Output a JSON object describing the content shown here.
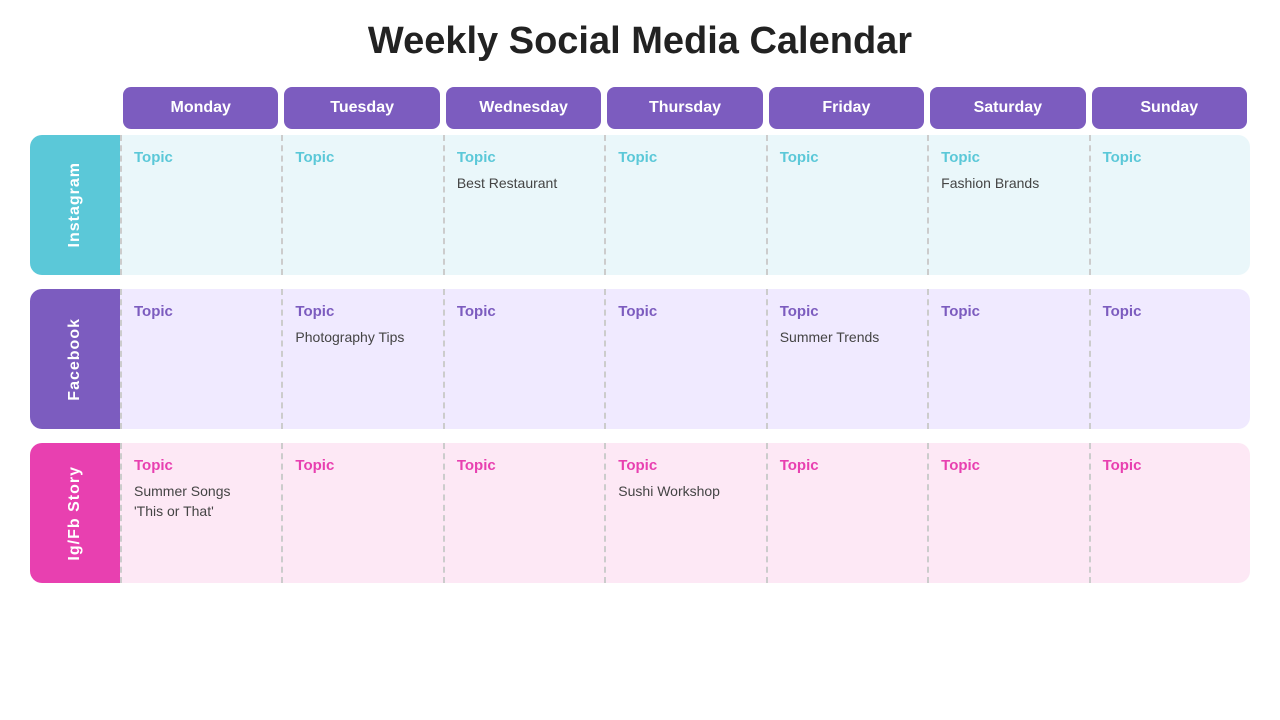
{
  "title": "Weekly Social Media Calendar",
  "days": [
    "Monday",
    "Tuesday",
    "Wednesday",
    "Thursday",
    "Friday",
    "Saturday",
    "Sunday"
  ],
  "sections": [
    {
      "name": "Instagram",
      "labelClass": "instagram-label",
      "bgClass": "instagram-bg",
      "topicClass": "instagram-topic",
      "cells": [
        {
          "topic": "Topic",
          "content": ""
        },
        {
          "topic": "Topic",
          "content": ""
        },
        {
          "topic": "Topic",
          "content": "Best Restaurant"
        },
        {
          "topic": "Topic",
          "content": ""
        },
        {
          "topic": "Topic",
          "content": ""
        },
        {
          "topic": "Topic",
          "content": "Fashion Brands"
        },
        {
          "topic": "Topic",
          "content": ""
        }
      ]
    },
    {
      "name": "Facebook",
      "labelClass": "facebook-label",
      "bgClass": "facebook-bg",
      "topicClass": "facebook-topic",
      "cells": [
        {
          "topic": "Topic",
          "content": ""
        },
        {
          "topic": "Topic",
          "content": "Photography Tips"
        },
        {
          "topic": "Topic",
          "content": ""
        },
        {
          "topic": "Topic",
          "content": ""
        },
        {
          "topic": "Topic",
          "content": "Summer Trends"
        },
        {
          "topic": "Topic",
          "content": ""
        },
        {
          "topic": "Topic",
          "content": ""
        }
      ]
    },
    {
      "name": "Ig/Fb Story",
      "labelClass": "story-label",
      "bgClass": "story-bg",
      "topicClass": "story-topic",
      "cells": [
        {
          "topic": "Topic",
          "content": "Summer Songs\n'This or That'"
        },
        {
          "topic": "Topic",
          "content": ""
        },
        {
          "topic": "Topic",
          "content": ""
        },
        {
          "topic": "Topic",
          "content": "Sushi Workshop"
        },
        {
          "topic": "Topic",
          "content": ""
        },
        {
          "topic": "Topic",
          "content": ""
        },
        {
          "topic": "Topic",
          "content": ""
        }
      ]
    }
  ]
}
